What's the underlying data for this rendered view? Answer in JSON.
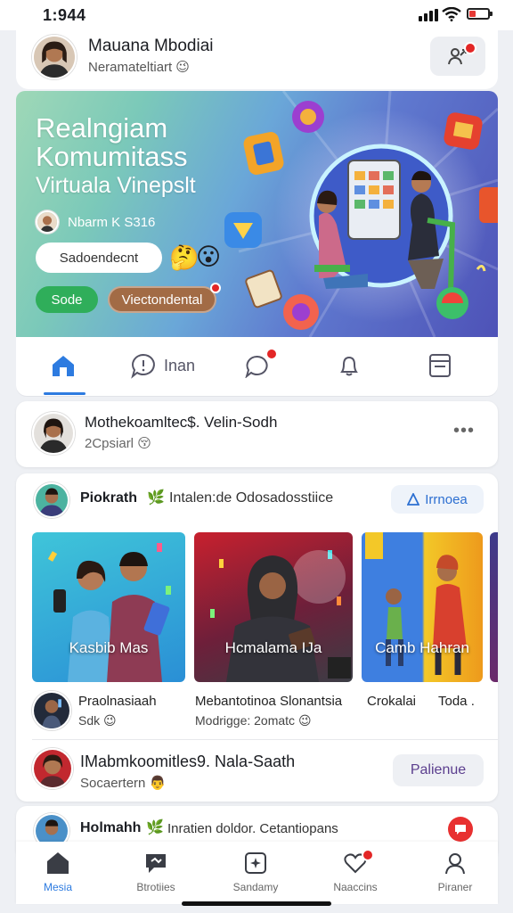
{
  "status_bar": {
    "time": "1:944"
  },
  "profile": {
    "name": "Mauana Mbodiai",
    "subtitle": "Neramateltiart",
    "emoji": "😉"
  },
  "hero": {
    "title_line1": "Realngiam",
    "title_line2": "Komumitass",
    "title_line3": "Virtuala Vinepslt",
    "meta": "Nbarm K S316",
    "input_value": "Sadoendecnt",
    "emoji_a": "🤔",
    "emoji_b": "😮",
    "green_button": "Sode",
    "brown_button": "Viectondental",
    "colors": {
      "green": "#2fae5a",
      "brown": "#a26b45",
      "accent": "#2d7be0"
    }
  },
  "tabs": [
    {
      "icon": "home-icon",
      "label": ""
    },
    {
      "icon": "chat-icon",
      "label": "Inan"
    },
    {
      "icon": "message-icon",
      "label": ""
    },
    {
      "icon": "bell-icon",
      "label": ""
    },
    {
      "icon": "bookmark-icon",
      "label": ""
    }
  ],
  "post1": {
    "title": "Mothekoamltec$. Velin-Sodh",
    "subtitle": "2Cpsiarl",
    "emoji": "😚",
    "more": "•••"
  },
  "post2": {
    "author": "Piokrath",
    "leaf": "🌿",
    "description": "Intalen:de Odosadosstiice",
    "follow_label": "Irrnoea",
    "thumbnails": [
      {
        "caption": "Kasbib Mas"
      },
      {
        "caption": "Hcmalama IJa"
      },
      {
        "caption": "Camb   Hahran"
      }
    ],
    "items": [
      {
        "title": "Praolnasiaah",
        "subtitle": "Sdk",
        "emoji": "😉"
      },
      {
        "title": "Mebantotinoa Slonantsia",
        "subtitle": "Modrigge: 2omatc",
        "emoji": "😉"
      },
      {
        "title": "Crokalai",
        "subtitle": ""
      },
      {
        "title": "Toda .",
        "subtitle": ""
      }
    ],
    "footer_title": "IMabmkoomitles9. Nala-Saath",
    "footer_subtitle": "Socaertern",
    "footer_emoji": "👨",
    "footer_button": "Palienue"
  },
  "post3": {
    "author": "Holmahh",
    "leaf": "🌿",
    "description": "Inratien doldor. Cetantiopans"
  },
  "nav": [
    {
      "icon": "home-icon",
      "label": "Mesia",
      "active": true
    },
    {
      "icon": "chat-icon",
      "label": "Btrotiies"
    },
    {
      "icon": "sparkle-card-icon",
      "label": "Sandamy"
    },
    {
      "icon": "heart-icon",
      "label": "Naaccins"
    },
    {
      "icon": "profile-icon",
      "label": "Piraner"
    }
  ]
}
